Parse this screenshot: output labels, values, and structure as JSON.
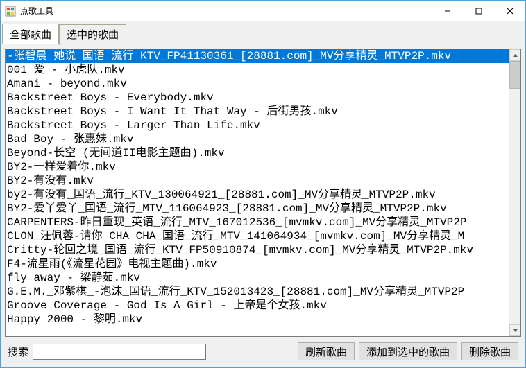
{
  "window": {
    "title": "点歌工具"
  },
  "tabs": {
    "active_index": 0,
    "items": [
      {
        "label": "全部歌曲"
      },
      {
        "label": "选中的歌曲"
      }
    ]
  },
  "songs": [
    {
      "name": "-张碧晨 她说 国语 流行 KTV_FP41130361_[28881.com]_MV分享精灵_MTVP2P.mkv",
      "selected": true
    },
    {
      "name": "001 爱 - 小虎队.mkv",
      "selected": false
    },
    {
      "name": "Amani - beyond.mkv",
      "selected": false
    },
    {
      "name": "Backstreet Boys - Everybody.mkv",
      "selected": false
    },
    {
      "name": "Backstreet Boys - I Want It That Way - 后街男孩.mkv",
      "selected": false
    },
    {
      "name": "Backstreet Boys - Larger Than Life.mkv",
      "selected": false
    },
    {
      "name": "Bad Boy - 张惠妹.mkv",
      "selected": false
    },
    {
      "name": "Beyond-长空 (无间道II电影主题曲).mkv",
      "selected": false
    },
    {
      "name": "BY2-一样爱着你.mkv",
      "selected": false
    },
    {
      "name": "BY2-有没有.mkv",
      "selected": false
    },
    {
      "name": "by2-有没有_国语_流行_KTV_130064921_[28881.com]_MV分享精灵_MTVP2P.mkv",
      "selected": false
    },
    {
      "name": "BY2-爱丫爱丫_国语_流行_MTV_116064923_[28881.com]_MV分享精灵_MTVP2P.mkv",
      "selected": false
    },
    {
      "name": "CARPENTERS-昨日重现_英语_流行_MTV_167012536_[mvmkv.com]_MV分享精灵_MTVP2P",
      "selected": false
    },
    {
      "name": "CLON_汪佩蓉-请你 CHA CHA_国语_流行_MTV_141064934_[mvmkv.com]_MV分享精灵_M",
      "selected": false
    },
    {
      "name": "Critty-轮回之境_国语_流行_KTV_FP50910874_[mvmkv.com]_MV分享精灵_MTVP2P.mkv",
      "selected": false
    },
    {
      "name": "F4-流星雨(《流星花园》电视主题曲).mkv",
      "selected": false
    },
    {
      "name": "fly away  - 梁静茹.mkv",
      "selected": false
    },
    {
      "name": "G.E.M._邓紫棋_-泡沫_国语_流行_KTV_152013423_[28881.com]_MV分享精灵_MTVP2P",
      "selected": false
    },
    {
      "name": "Groove Coverage - God Is A Girl - 上帝是个女孩.mkv",
      "selected": false
    },
    {
      "name": "Happy 2000 - 黎明.mkv",
      "selected": false
    }
  ],
  "bottom": {
    "search_label": "搜索",
    "search_value": "",
    "refresh_label": "刷新歌曲",
    "add_label": "添加到选中的歌曲",
    "delete_label": "删除歌曲"
  }
}
